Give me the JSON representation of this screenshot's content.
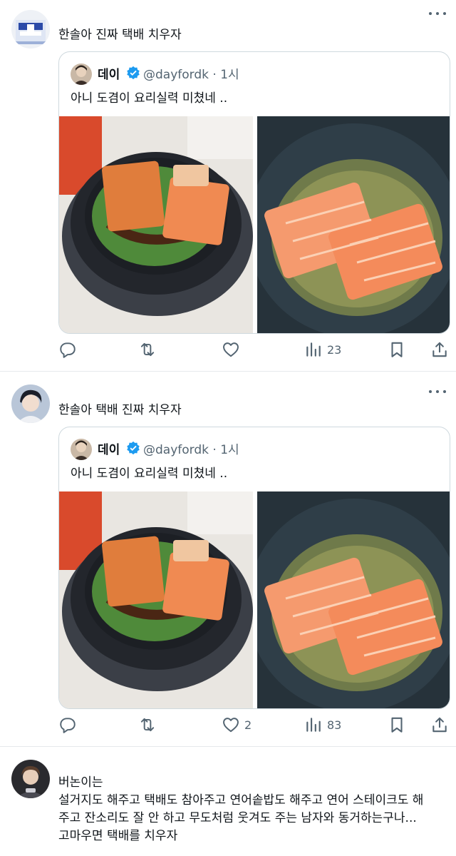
{
  "posts": [
    {
      "text": "한솔아 진짜 택배 치우자",
      "quote": {
        "name": "데이",
        "handle": "@dayfordk · 1시",
        "text": "아니 도겸이 요리실력 미쳤네 .."
      },
      "actions": {
        "reply": "",
        "repost": "",
        "like": "",
        "views": "23"
      }
    },
    {
      "text": "한솔아 택배 진짜 치우자",
      "quote": {
        "name": "데이",
        "handle": "@dayfordk · 1시",
        "text": "아니 도겸이 요리실력 미쳤네 .."
      },
      "actions": {
        "reply": "",
        "repost": "",
        "like": "2",
        "views": "83"
      }
    },
    {
      "lines": [
        "버논이는",
        "설거지도 해주고 택배도 참아주고 연어솥밥도 해주고 연어 스테이크도 해",
        "주고 잔소리도 잘 안 하고 무도처럼 웃겨도 주는 남자와 동거하는구나...",
        "고마우면 택배를 치우자"
      ]
    }
  ],
  "colors": {
    "text": "#0f1419",
    "muted": "#536471",
    "border": "#cfd9de",
    "divider": "#e6e9ec",
    "verified": "#1d9bf0",
    "salmon": "#f0824f",
    "pan": "#26323a"
  },
  "icons": [
    "more-icon",
    "reply-icon",
    "repost-icon",
    "like-icon",
    "views-icon",
    "bookmark-icon",
    "share-icon",
    "verified-icon"
  ]
}
